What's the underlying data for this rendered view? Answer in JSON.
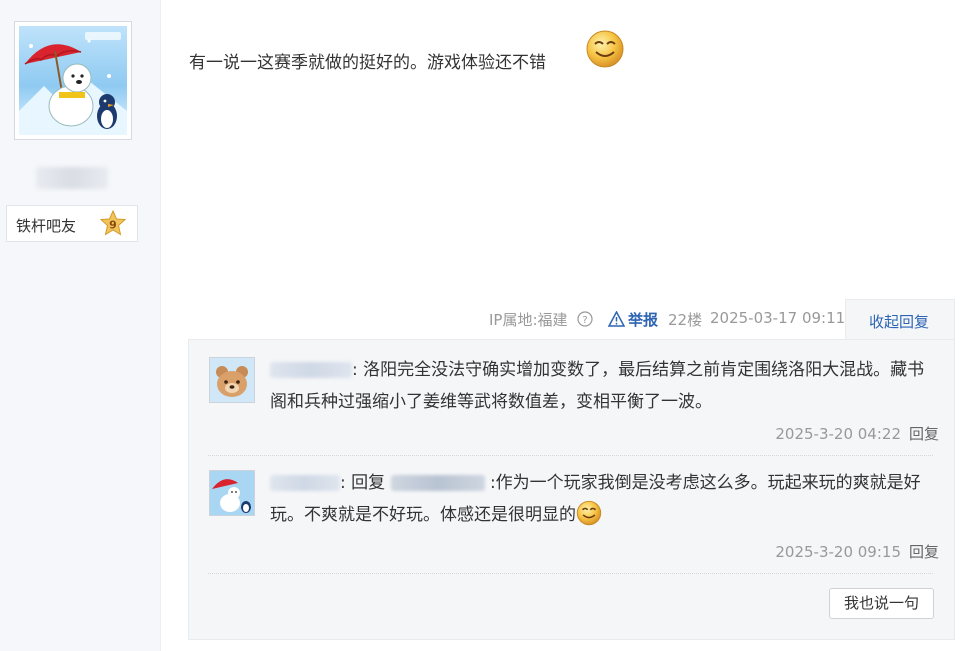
{
  "user": {
    "level_label": "铁杆吧友",
    "level_number": "9"
  },
  "post": {
    "content": "有一说一这赛季就做的挺好的。游戏体验还不错"
  },
  "meta": {
    "ip_label": "IP属地:福建",
    "report_label": "举报",
    "floor": "22楼",
    "time": "2025-03-17 09:11",
    "collapse_label": "收起回复"
  },
  "replies": [
    {
      "author_visible": ":",
      "text": "洛阳完全没法守确实增加变数了，最后结算之前肯定围绕洛阳大混战。藏书阁和兵种过强缩小了姜维等武将数值差，变相平衡了一波。",
      "time": "2025-3-20 04:22",
      "action": "回复"
    },
    {
      "author_visible": ":",
      "reply_word": "回复",
      "text_before_emoji": ":作为一个玩家我倒是没考虑这么多。玩起来玩的爽就是好玩。不爽就是不好玩。体感还是很明显的",
      "time": "2025-3-20 09:15",
      "action": "回复"
    }
  ],
  "say_button": "我也说一句",
  "icons": {
    "help": "question-circle-icon",
    "warning": "warning-triangle-icon",
    "smiley": "smiley-emoji-icon",
    "level_star": "star-badge-icon"
  },
  "colors": {
    "link_blue": "#2d64b3",
    "meta_gray": "#999999",
    "badge_gold": "#e8b94a"
  }
}
